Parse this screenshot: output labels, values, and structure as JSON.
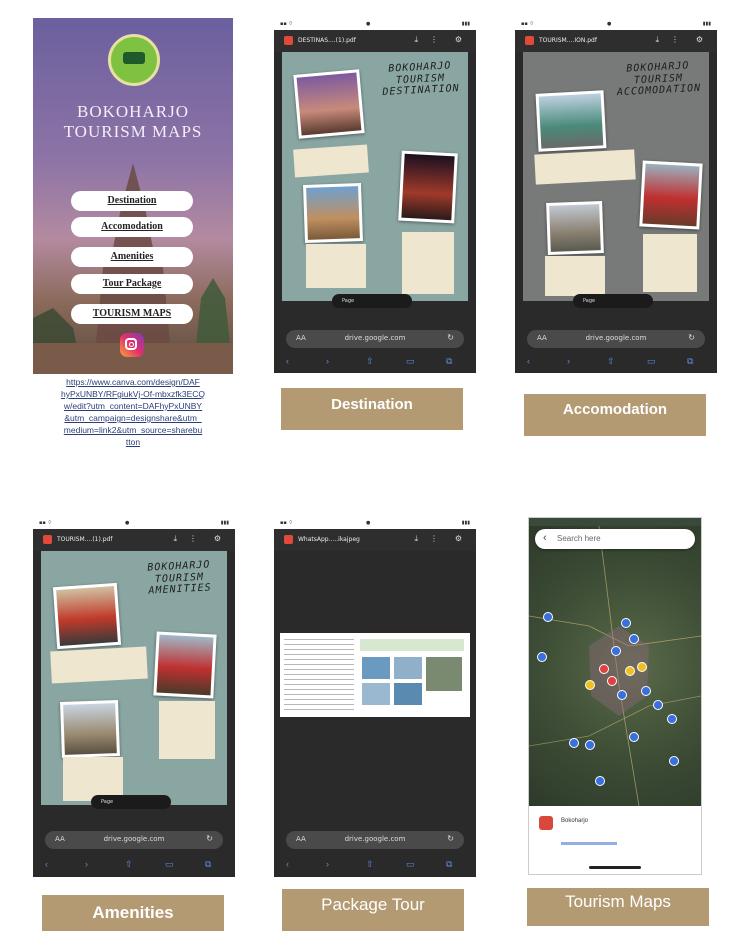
{
  "panel1": {
    "title_line1": "BOKOHARJO",
    "title_line2": "TOURISM MAPS",
    "subtitle": "",
    "buttons": [
      "Destination",
      "Accomodation",
      "Amenities",
      "Tour Package",
      "TOURISM MAPS"
    ],
    "link": "https://www.canva.com/design/DAFhyPxUNBY/RFgiukVj-Of-mbxzfk3ECQ/edit?utm_content=DAFhyPxUNBY&utm_campaign=designshare&utm_medium=link2&utm_source=sharebutton",
    "link_lines": [
      "https://www.canva.com/design/DAF",
      "hyPxUNBY/RFgiukVj-Of-mbxzfk3ECQ",
      "w/edit?utm_content=DAFhyPxUNBY",
      "&utm_campaign=designshare&utm_",
      "medium=link2&utm_source=sharebu",
      "tton"
    ]
  },
  "panel2": {
    "pdf_title": "DESTINAS....(1).pdf",
    "poster_title": [
      "BOKOHARJO",
      "TOURISM",
      "DESTINATION"
    ],
    "url": "drive.google.com",
    "aa": "AA",
    "page_label": "Page",
    "caption": "Destination"
  },
  "panel3": {
    "pdf_title": "TOURISM....ION.pdf",
    "poster_title": [
      "BOKOHARJO",
      "TOURISM",
      "ACCOMODATION"
    ],
    "url": "drive.google.com",
    "aa": "AA",
    "page_label": "Page",
    "caption": "Accomodation"
  },
  "panel4": {
    "pdf_title": "TOURISM....(1).pdf",
    "poster_title": [
      "BOKOHARJO",
      "TOURISM",
      "AMENITIES"
    ],
    "url": "drive.google.com",
    "aa": "AA",
    "page_label": "Page",
    "caption": "Amenities"
  },
  "panel5": {
    "pdf_title": "WhatsApp.....ikajpeg",
    "url": "drive.google.com",
    "aa": "AA",
    "caption": "Package Tour"
  },
  "panel6": {
    "search_placeholder": "Search here",
    "place_name": "Bokoharjo",
    "caption": "Tourism Maps"
  },
  "colors": {
    "caption_bg": "#b39a73",
    "poster_teal": "#8aa6a3",
    "poster_gray": "#777a78",
    "phone_dark": "#2a2a2a"
  }
}
